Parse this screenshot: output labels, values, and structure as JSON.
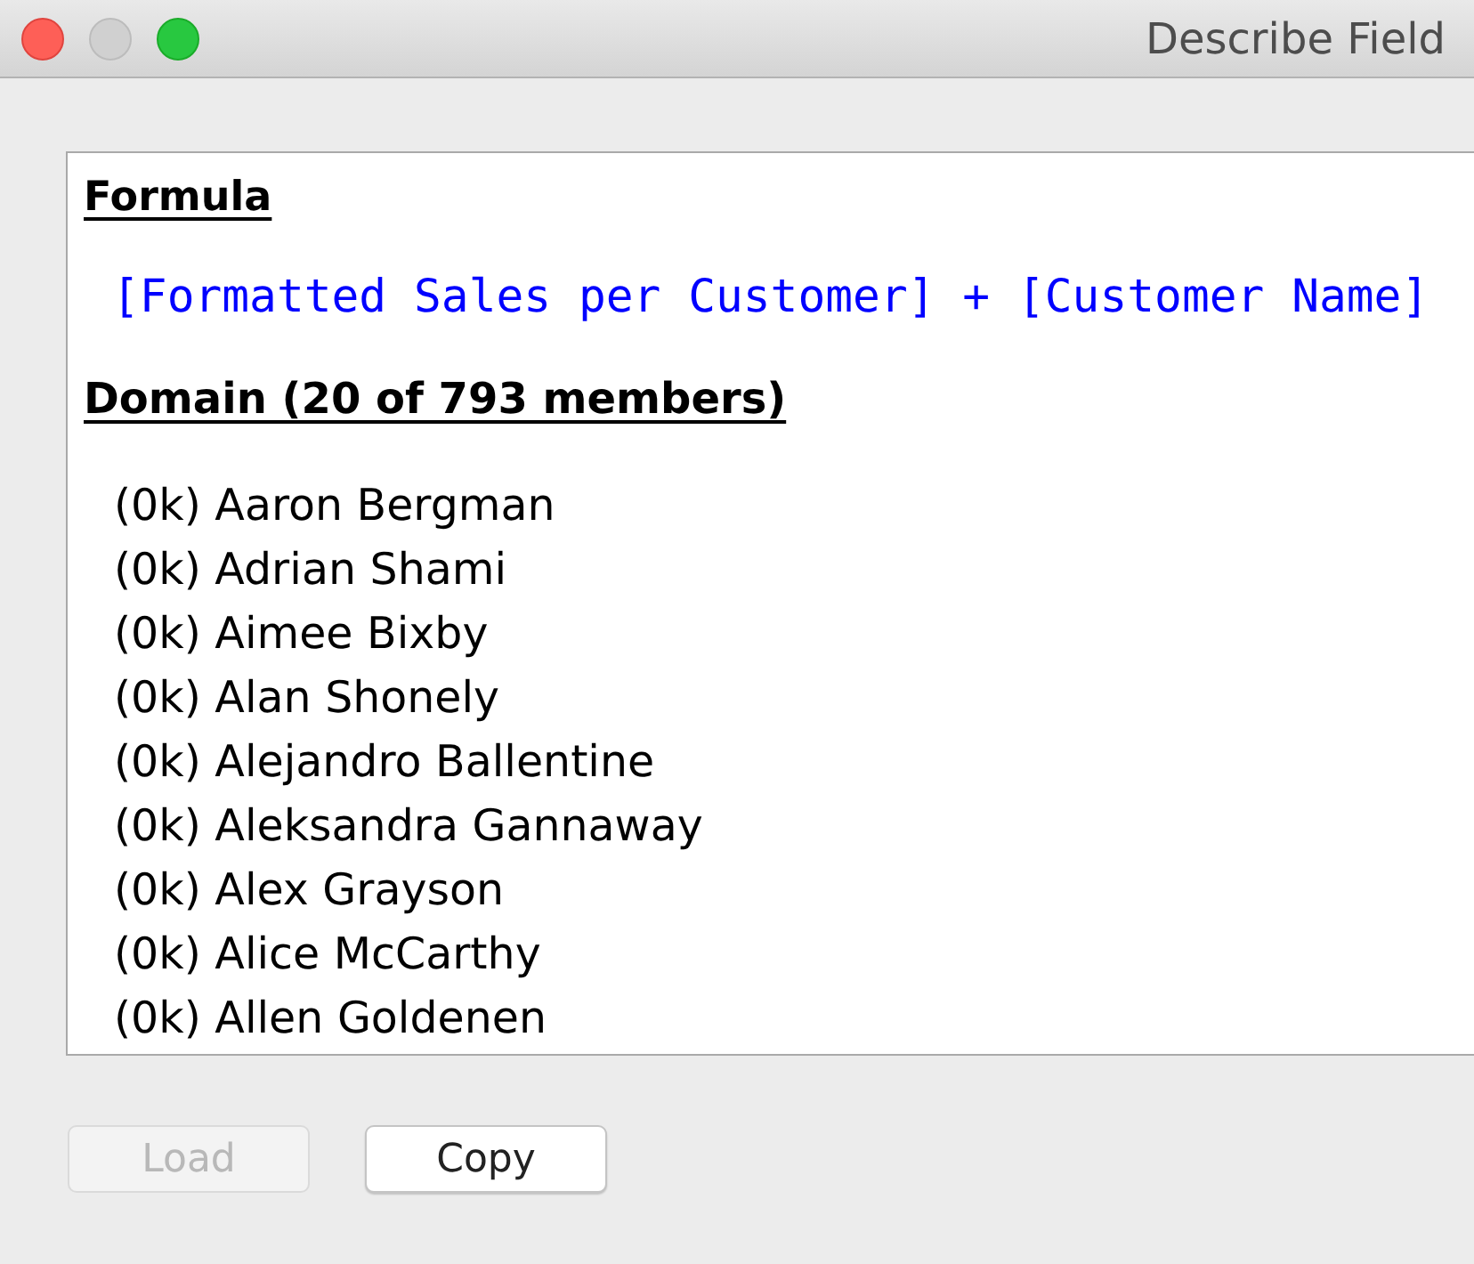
{
  "window": {
    "title": "Describe Field",
    "controls": [
      {
        "kind": "close",
        "disabled": false
      },
      {
        "kind": "minimize",
        "disabled": true
      },
      {
        "kind": "zoom",
        "disabled": false
      }
    ]
  },
  "formula": {
    "heading": "Formula",
    "expression": "[Formatted Sales per Customer] + [Customer Name]"
  },
  "domain": {
    "heading": "Domain (20 of 793 members)",
    "members": [
      "(0k) Aaron Bergman",
      "(0k) Adrian Shami",
      "(0k) Aimee Bixby",
      "(0k) Alan Shonely",
      "(0k) Alejandro Ballentine",
      "(0k) Aleksandra Gannaway",
      "(0k) Alex Grayson",
      "(0k) Alice McCarthy",
      "(0k) Allen Goldenen"
    ]
  },
  "buttons": [
    {
      "label": "Load",
      "disabled": true
    },
    {
      "label": "Copy",
      "disabled": false
    }
  ]
}
